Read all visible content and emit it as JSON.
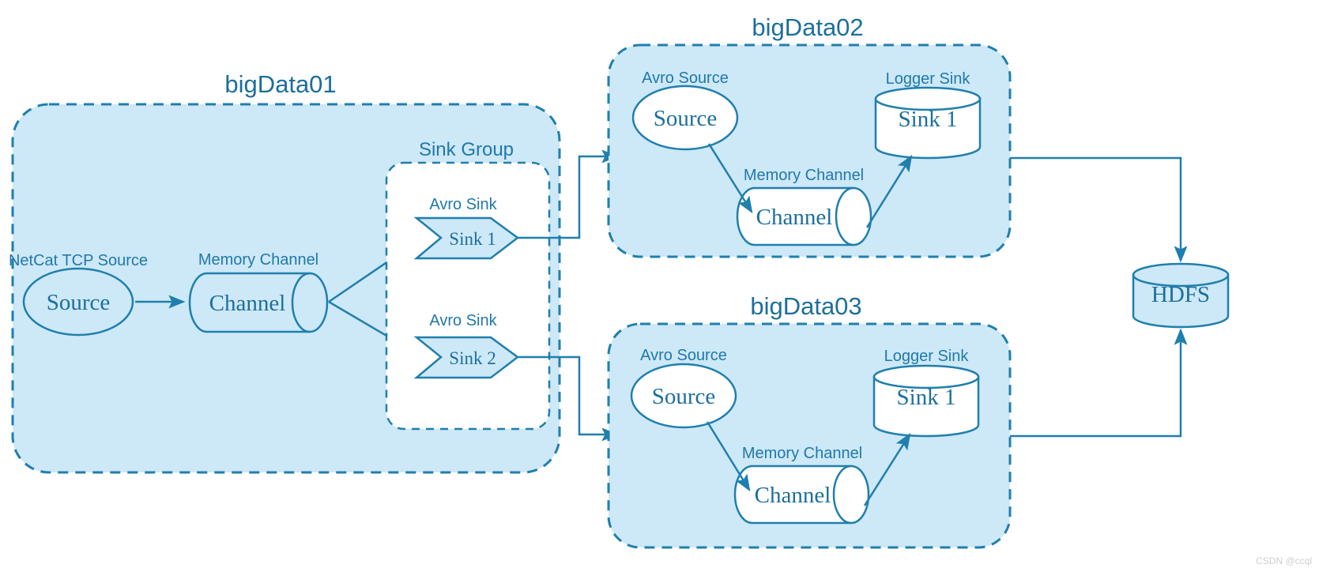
{
  "diagram": {
    "title_hosts": {
      "host1": "bigData01",
      "host2": "bigData02",
      "host3": "bigData03"
    },
    "colors": {
      "fill_light_blue": "#cde8f7",
      "stroke_blue": "#1f7fad",
      "text_blue": "#1c6f9c",
      "label_blue": "#2079ab",
      "white": "#ffffff",
      "watermark_gray": "#cfcfcf"
    },
    "host1": {
      "name": "bigData01",
      "source": {
        "caption": "NetCat TCP Source",
        "shape_label": "Source"
      },
      "channel": {
        "caption": "Memory Channel",
        "shape_label": "Channel"
      },
      "sink_group": {
        "caption": "Sink Group",
        "sinks": [
          {
            "caption": "Avro Sink",
            "shape_label": "Sink 1"
          },
          {
            "caption": "Avro Sink",
            "shape_label": "Sink 2"
          }
        ]
      }
    },
    "host2": {
      "name": "bigData02",
      "source": {
        "caption": "Avro Source",
        "shape_label": "Source"
      },
      "channel": {
        "caption": "Memory Channel",
        "shape_label": "Channel"
      },
      "sink": {
        "caption": "Logger Sink",
        "shape_label": "Sink 1"
      }
    },
    "host3": {
      "name": "bigData03",
      "source": {
        "caption": "Avro Source",
        "shape_label": "Source"
      },
      "channel": {
        "caption": "Memory Channel",
        "shape_label": "Channel"
      },
      "sink": {
        "caption": "Logger Sink",
        "shape_label": "Sink 1"
      }
    },
    "storage": {
      "shape_label": "HDFS"
    },
    "watermark": "CSDN @ccql"
  }
}
